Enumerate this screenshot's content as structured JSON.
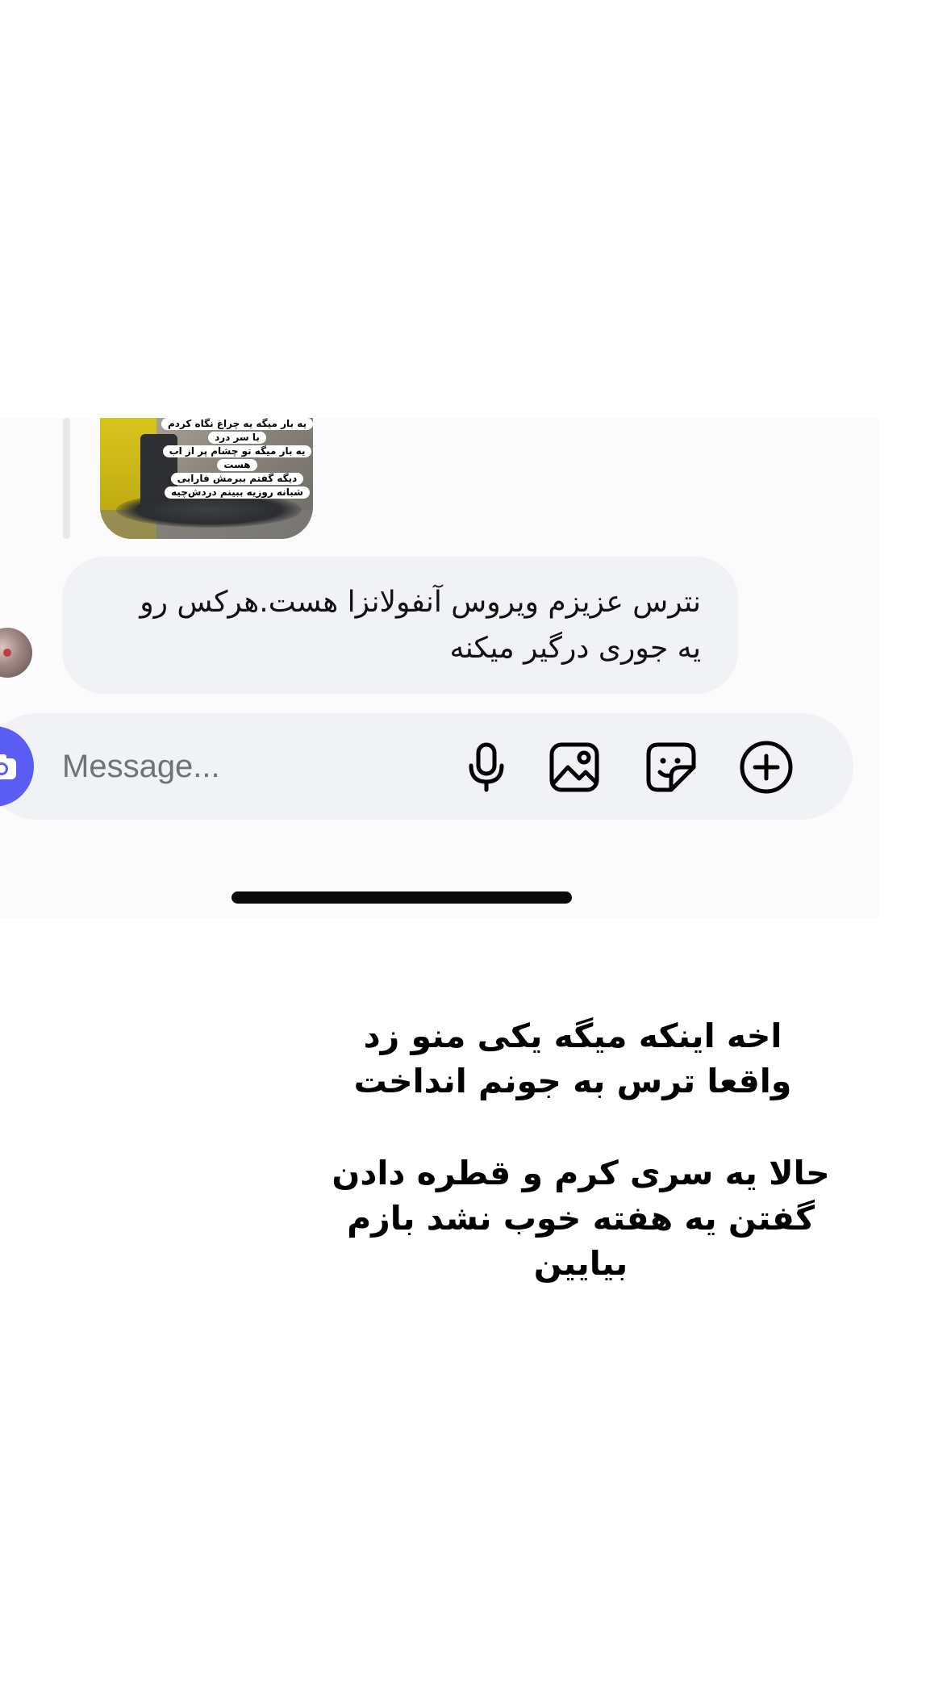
{
  "chat": {
    "image_reply": {
      "lines": [
        "یه بار میگه یه چراغ نگاه کردم",
        "با سر درد",
        "یه بار میگه تو چشام پر از اب",
        "هست",
        "دیگه گفتم ببرمش فارابی",
        "شبانه روزیه ببینم دردش‌چیه"
      ]
    },
    "received_message": {
      "line1": "نترس عزیزم ویروس آنفولانزا هست.هرکس رو",
      "line2": "یه جوری درگیر میکنه"
    },
    "composer": {
      "placeholder": "Message...",
      "icons": [
        "camera-icon",
        "microphone-icon",
        "image-icon",
        "sticker-icon",
        "plus-circle-icon"
      ]
    }
  },
  "overlay": {
    "caption_1": "اخه اینکه میگه یکی منو زد\nواقعا ترس به جونم انداخت",
    "caption_2": "حالا یه سری کرم و قطره دادن\nگفتن یه هفته خوب نشد بازم\nبیایین"
  },
  "colors": {
    "accent": "#5b5ef5",
    "bubble": "#f1f2f5",
    "placeholder": "#6f7277"
  }
}
